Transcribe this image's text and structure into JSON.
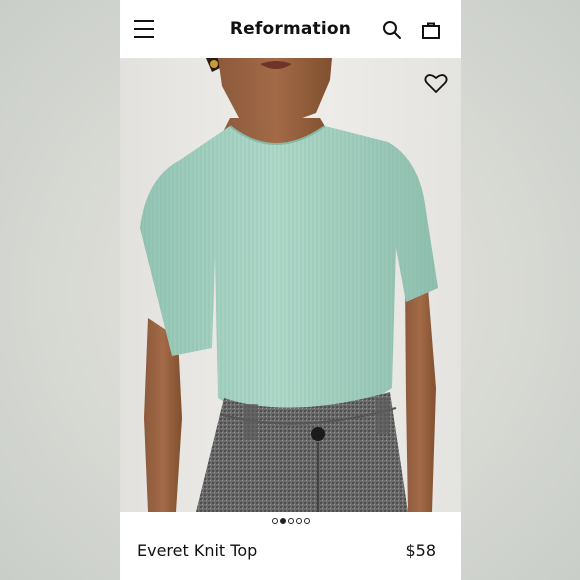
{
  "header": {
    "brand": "Reformation",
    "menu_icon": "hamburger-menu-icon",
    "search_icon": "search-icon",
    "bag_icon": "shopping-bag-icon"
  },
  "gallery": {
    "favorite_icon": "heart-outline-icon",
    "image_count": 5,
    "active_index": 1
  },
  "product": {
    "name": "Everet Knit Top",
    "price": "$58"
  },
  "colors": {
    "top": "#a8d3c3",
    "skirt": "#6d6d6d",
    "background": "#ecebe8"
  }
}
